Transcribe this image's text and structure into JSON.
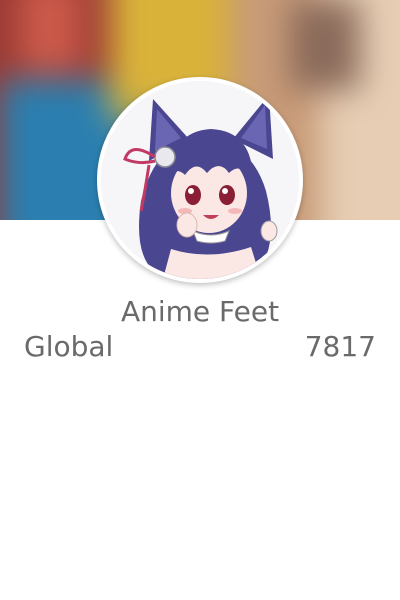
{
  "profile": {
    "name": "Anime Feet",
    "avatar_icon": "anime-catgirl-avatar"
  },
  "stats": {
    "label": "Global",
    "value": "7817"
  },
  "colors": {
    "text": "#6a6a6a",
    "background": "#ffffff",
    "avatar_border": "#ffffff"
  }
}
